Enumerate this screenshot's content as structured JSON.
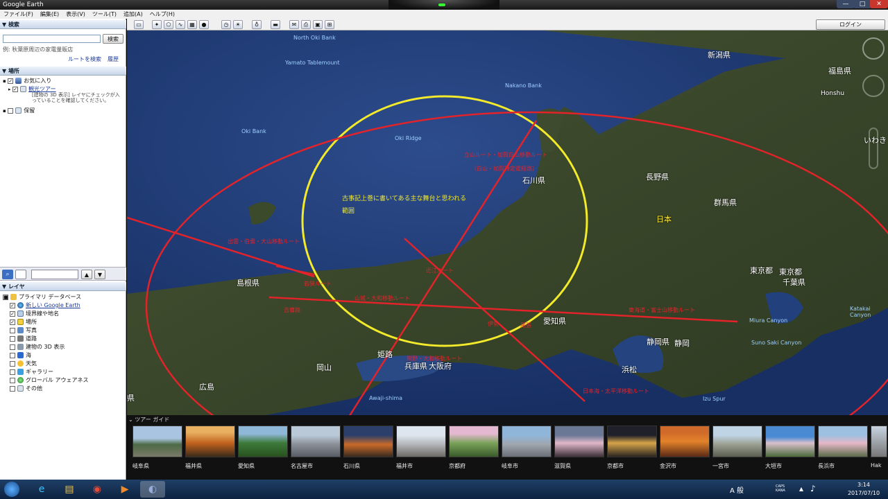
{
  "window": {
    "title": "Google Earth",
    "min": "—",
    "max": "□",
    "close": "✕"
  },
  "menu": [
    "ファイル(F)",
    "編集(E)",
    "表示(V)",
    "ツール(T)",
    "追加(A)",
    "ヘルプ(H)"
  ],
  "search": {
    "header": "▼ 検索",
    "button": "検索",
    "example": "例: 秋葉原周辺の家電量販店",
    "route": "ルートを検索",
    "history": "履歴"
  },
  "places": {
    "header": "▼ 場所",
    "items": [
      {
        "label": "お気に入り"
      },
      {
        "label": "観光ツアー",
        "note": "[建物の 3D 表示] レイヤにチェックが入っていることを確認してください。"
      },
      {
        "label": "保留"
      }
    ]
  },
  "layers": {
    "header": "▼ レイヤ",
    "items": [
      {
        "label": "プライマリ データベース",
        "checked": "■",
        "link": false
      },
      {
        "label": "新しい Google Earth",
        "checked": "✓",
        "link": true
      },
      {
        "label": "境界線や地名",
        "checked": "✓",
        "link": false
      },
      {
        "label": "場所",
        "checked": "✓",
        "link": false
      },
      {
        "label": "写真",
        "checked": "",
        "link": false
      },
      {
        "label": "道路",
        "checked": "",
        "link": false
      },
      {
        "label": "建物の 3D 表示",
        "checked": "",
        "link": false
      },
      {
        "label": "海",
        "checked": "",
        "link": false
      },
      {
        "label": "天気",
        "checked": "",
        "link": false
      },
      {
        "label": "ギャラリー",
        "checked": "",
        "link": false
      },
      {
        "label": "グローバル アウェアネス",
        "checked": "",
        "link": false
      },
      {
        "label": "その他",
        "checked": "",
        "link": false
      }
    ]
  },
  "toolbar": {
    "login": "ログイン"
  },
  "map": {
    "places": [
      {
        "name": "新潟県"
      },
      {
        "name": "福島県"
      },
      {
        "name": "Honshu"
      },
      {
        "name": "いわき"
      },
      {
        "name": "石川県"
      },
      {
        "name": "長野県"
      },
      {
        "name": "群馬県"
      },
      {
        "name": "日本"
      },
      {
        "name": "東京都"
      },
      {
        "name": "千葉県"
      },
      {
        "name": "島根県"
      },
      {
        "name": "愛知県"
      },
      {
        "name": "静岡県"
      },
      {
        "name": "静岡"
      },
      {
        "name": "浜松"
      },
      {
        "name": "姫路"
      },
      {
        "name": "兵庫県"
      },
      {
        "name": "大阪府"
      },
      {
        "name": "岡山"
      },
      {
        "name": "広島"
      },
      {
        "name": "県"
      },
      {
        "name": "東京都"
      }
    ],
    "sea_labels": [
      {
        "name": "North Oki Bank"
      },
      {
        "name": "Yamato Tablemount"
      },
      {
        "name": "Oki Bank"
      },
      {
        "name": "Oki Ridge"
      },
      {
        "name": "Nakano Bank"
      },
      {
        "name": "Awaji-shima"
      },
      {
        "name": "Miura Canyon"
      },
      {
        "name": "Suno Saki Canyon"
      },
      {
        "name": "Izu Spur"
      },
      {
        "name": "Katakai Canyon"
      }
    ],
    "annotation": "古事記上巻に書いてある主な舞台と思われる範囲",
    "red_labels": [
      {
        "text": "立山ルート・加賀白山移動ルート"
      },
      {
        "text": "（白山・加賀禅定道経路）"
      },
      {
        "text": "出雲・伯耆・大山移動ルート"
      },
      {
        "text": "近江ルート"
      },
      {
        "text": "若狭ルート"
      },
      {
        "text": "山城・大和移動ルート"
      },
      {
        "text": "吉備路"
      },
      {
        "text": "伊勢"
      },
      {
        "text": "尾張"
      },
      {
        "text": "熊野・大和移動ルート"
      },
      {
        "text": "日本海・太平洋移動ルート"
      },
      {
        "text": "東海道・富士山移動ルート"
      }
    ],
    "colors": {
      "sea": "#1e3a78",
      "land": "#3d4a2a",
      "red": "#e2232a",
      "yellow": "#f2ea2a"
    }
  },
  "tour": {
    "header": "ツアー ガイド",
    "items": [
      "岐阜県",
      "福井県",
      "愛知県",
      "名古屋市",
      "石川県",
      "福井市",
      "京都府",
      "岐阜市",
      "滋賀県",
      "京都市",
      "金沢市",
      "一宮市",
      "大垣市",
      "長浜市",
      "Hak"
    ]
  },
  "taskbar": {
    "time": "3:14",
    "date": "2017/07/10",
    "ime": "A 般",
    "caps": "CAPS KANA"
  }
}
